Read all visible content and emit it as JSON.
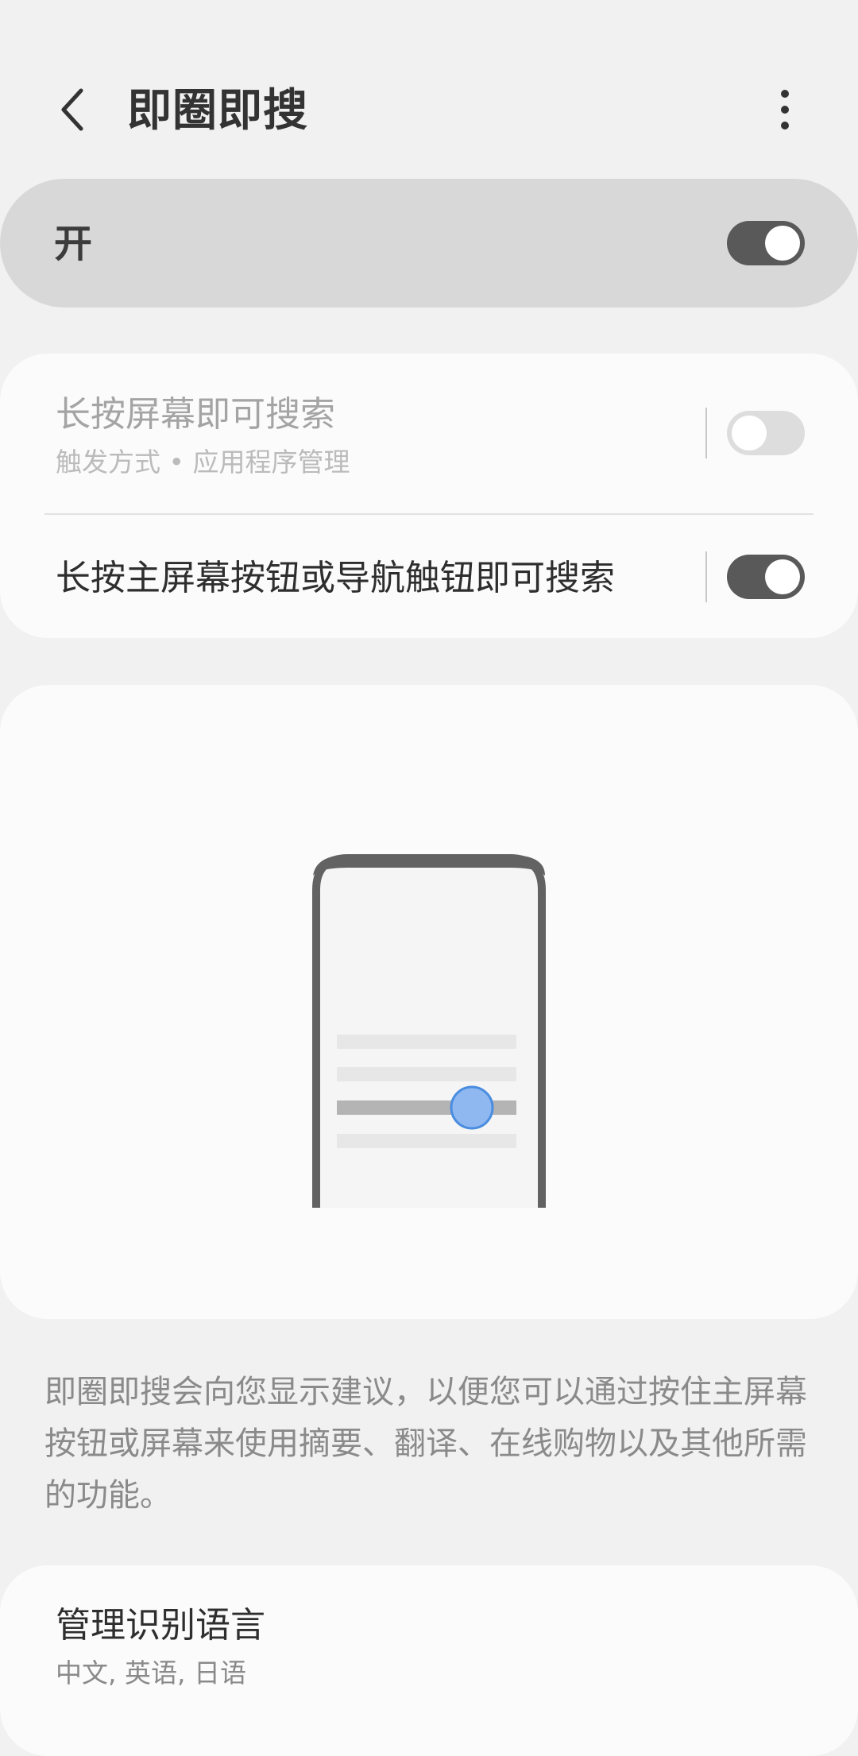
{
  "header": {
    "title": "即圈即搜",
    "back_icon": "chevron-left-icon",
    "more_icon": "more-vertical-icon"
  },
  "master": {
    "label": "开",
    "enabled": true
  },
  "options": [
    {
      "title": "长按屏幕即可搜索",
      "subtitle": "触发方式 • 应用程序管理",
      "enabled": false,
      "disabled_appearance": true
    },
    {
      "title": "长按主屏幕按钮或导航触钮即可搜索",
      "enabled": true
    }
  ],
  "description": "即圈即搜会向您显示建议，以便您可以通过按住主屏幕按钮或屏幕来使用摘要、翻译、在线购物以及其他所需的功能。",
  "languages": {
    "title": "管理识别语言",
    "value": "中文, 英语, 日语"
  },
  "colors": {
    "background": "#f1f1f1",
    "master_bar": "#d8d8d8",
    "card": "#fbfbfb",
    "toggle_on": "#595959",
    "toggle_off": "#dddddd",
    "touch_point": "#8fb8f0"
  }
}
